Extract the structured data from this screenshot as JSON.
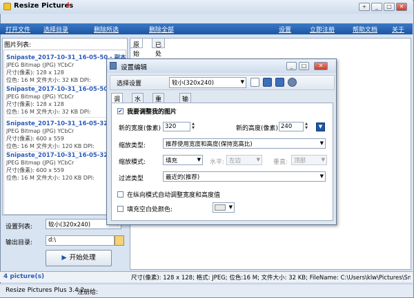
{
  "app": {
    "title": "Resize Pictures",
    "title_plus": "+",
    "window_controls": [
      "+",
      "_",
      "□",
      "✕"
    ]
  },
  "menu": {
    "items": [
      {
        "label": "打开文件"
      },
      {
        "label": "选择目录"
      },
      {
        "label": "删除所选"
      },
      {
        "label": "删除全部"
      },
      {
        "label": "设置"
      },
      {
        "label": "立即注册"
      },
      {
        "label": "帮助文档"
      },
      {
        "label": "关于"
      }
    ]
  },
  "left": {
    "list_label": "图片列表:",
    "items": [
      {
        "name": "Snipaste_2017-10-31_16-05-50 - 副本.j",
        "format": "JPEG Bitmap (JPG) YCbCr",
        "size": "尺寸(像素): 128 x 128",
        "meta": "位色: 16 M  文件大小: 32 KB  DPI:"
      },
      {
        "name": "Snipaste_2017-10-31_16-05-50.jpg",
        "format": "JPEG Bitmap (JPG) YCbCr",
        "size": "尺寸(像素): 128 x 128",
        "meta": "位色: 16 M  文件大小: 32 KB  DPI:"
      },
      {
        "name": "Snipaste_2017-10-31_16-05-32 - 副本.j",
        "format": "JPEG Bitmap (JPG) YCbCr",
        "size": "尺寸(像素): 600 x 559",
        "meta": "位色: 16 M  文件大小: 120 KB  DPI:"
      },
      {
        "name": "Snipaste_2017-10-31_16-05-32.jpg",
        "format": "JPEG Bitmap (JPG) YCbCr",
        "size": "尺寸(像素): 600 x 559",
        "meta": "位色: 16 M  文件大小: 120 KB  DPI:"
      }
    ],
    "settings_label": "设置列表:",
    "settings_value": "较小(320x240)",
    "output_label": "输出目录:",
    "output_value": "d:\\",
    "start_label": "开始处理"
  },
  "preview_tabs": [
    {
      "label": "原始"
    },
    {
      "label": "已处理"
    }
  ],
  "status": {
    "count": "4 picture(s)",
    "fileinfo": "尺寸(像素): 128 x 128;  格式: JPEG;  位色:16 M;  文件大小: 32 KB;  FileName: C:\\Users\\klw\\Pictures\\Sn",
    "version": "Resize Pictures Plus 3.4.2",
    "registered": "注册给:"
  },
  "dialog": {
    "title": "设置编辑",
    "controls": [
      "_",
      "□",
      "✕"
    ],
    "select_label": "选择设置",
    "select_value": "较小(320x240)",
    "tabs": [
      {
        "label": "调整"
      },
      {
        "label": "水印"
      },
      {
        "label": "重命名"
      },
      {
        "label": "输出"
      }
    ],
    "resize_check": "我要调整我的图片",
    "new_width_label": "新的宽度(像素)",
    "new_width_value": "320",
    "new_height_label": "新的高度(像素)",
    "new_height_value": "240",
    "scale_type_label": "缩放类型:",
    "scale_type_value": "推荐使用宽度和高度(保持宽高比)",
    "scale_mode_label": "缩放模式:",
    "scale_mode_value": "填充",
    "horiz_label": "水平:",
    "horiz_value": "左边",
    "vert_label": "垂直:",
    "vert_value": "顶部",
    "filter_label": "过滤类型",
    "filter_value": "最近的(推荐)",
    "portrait_check": "在纵向模式自动调整宽度和高度值",
    "fill_check": "填充空白处颜色:"
  }
}
